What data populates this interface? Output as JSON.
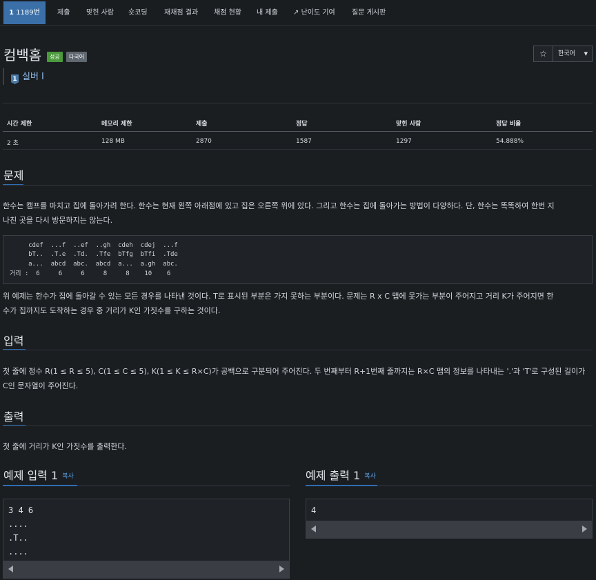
{
  "nav": {
    "problem_number": "1189번",
    "level_badge": "1",
    "items": [
      "제출",
      "맞힌 사람",
      "숏코딩",
      "재채점 결과",
      "채점 현황",
      "내 제출",
      "난이도 기여",
      "질문 게시판"
    ]
  },
  "problem": {
    "title": "컴백홈",
    "badge_success": "성공",
    "badge_multi": "다국어",
    "tier_icon": "1",
    "tier": "실버 I",
    "star": "☆",
    "language": "한국어"
  },
  "info": {
    "headers": [
      "시간 제한",
      "메모리 제한",
      "제출",
      "정답",
      "맞힌 사람",
      "정답 비율"
    ],
    "values": [
      "2 초",
      "128 MB",
      "2870",
      "1587",
      "1297",
      "54.888%"
    ]
  },
  "sections": {
    "problem_title": "문제",
    "problem_p1_line1": "한수는 캠프를 마치고 집에 돌아가려 한다. 한수는 현재 왼쪽 아래점에 있고 집은 오른쪽 위에 있다. 그리고 한수는 집에 돌아가는 방법이 다양하다. 단, 한수는 똑똑하여 한번 지",
    "problem_p1_line2": "나친 곳을 다시 방문하지는 않는다.",
    "pre_lines": [
      "     cdef  ...f  ..ef  ..gh  cdeh  cdej  ...f",
      "     bT..  .T.e  .Td.  .Tfe  bTfg  bTfi  .Tde",
      "     a...  abcd  abc.  abcd  a...  a.gh  abc.",
      "거리 :  6     6     6     8     8    10    6"
    ],
    "problem_p2_line1": "위 예제는 한수가 집에 돌아갈 수 있는 모든 경우를 나타낸 것이다. T로 표시된 부분은 가지 못하는 부분이다. 문제는 R x C 맵에 못가는 부분이 주어지고 거리 K가 주어지면 한",
    "problem_p2_line2": "수가 집까지도 도착하는 경우 중 거리가 K인 가짓수를 구하는 것이다.",
    "input_title": "입력",
    "input_line1": "첫 줄에 정수 R(1 ≤ R ≤ 5), C(1 ≤ C ≤ 5), K(1 ≤ K ≤ R×C)가 공백으로 구분되어 주어진다. 두 번째부터 R+1번째 줄까지는 R×C 맵의 정보를 나타내는 '.'과 'T'로 구성된 길이가",
    "input_line2": "C인 문자열이 주어진다.",
    "output_title": "출력",
    "output_line1": "첫 줄에 거리가 K인 가짓수를 출력한다."
  },
  "samples": {
    "input_title": "예제 입력 1",
    "output_title": "예제 출력 1",
    "copy": "복사",
    "input_lines": [
      "3 4 6",
      "....",
      ".T..",
      "...."
    ],
    "output_lines": [
      "4"
    ]
  },
  "colors": {
    "accent": "#3a6fa8",
    "success": "#4a9a3b",
    "link": "#5aa0e6"
  }
}
